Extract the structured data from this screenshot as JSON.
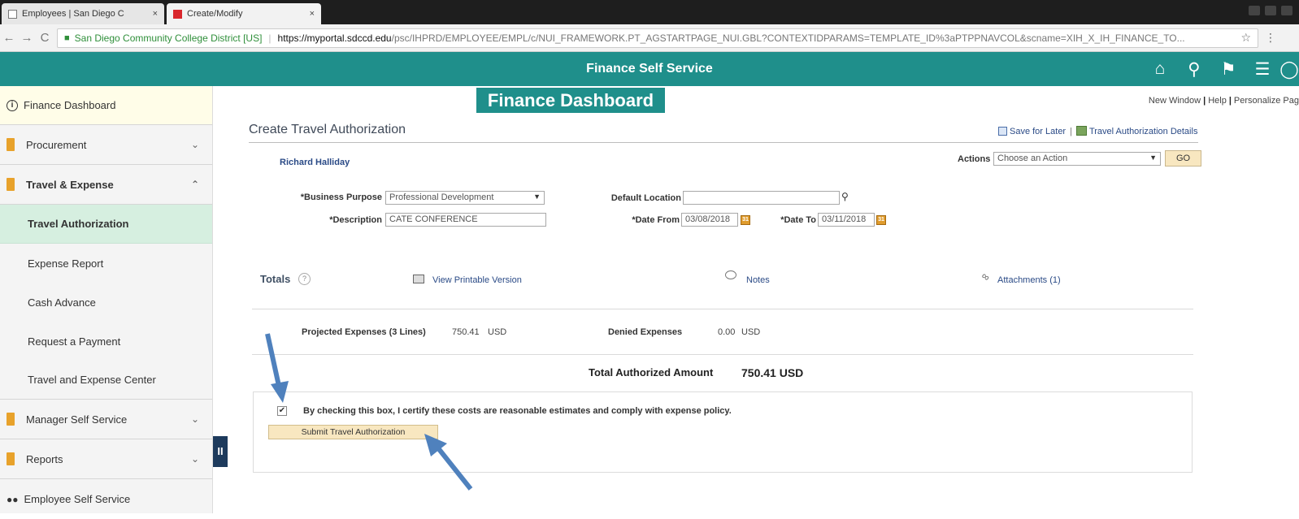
{
  "browser": {
    "tabs": [
      {
        "label": "Employees | San Diego C",
        "close": "×"
      },
      {
        "label": "Create/Modify",
        "close": "×"
      }
    ],
    "secure_label": "San Diego Community College District [US]",
    "url_host": "https://myportal.sdccd.edu",
    "url_path": "/psc/IHPRD/EMPLOYEE/EMPL/c/NUI_FRAMEWORK.PT_AGSTARTPAGE_NUI.GBL?CONTEXTIDPARAMS=TEMPLATE_ID%3aPTPPNAVCOL&scname=XIH_X_IH_FINANCE_TO..."
  },
  "header": {
    "title": "Finance Self Service"
  },
  "sidebar": {
    "items": [
      {
        "label": "Finance Dashboard"
      },
      {
        "label": "Procurement"
      },
      {
        "label": "Travel & Expense"
      },
      {
        "label": "Travel Authorization"
      },
      {
        "label": "Expense Report"
      },
      {
        "label": "Cash Advance"
      },
      {
        "label": "Request a Payment"
      },
      {
        "label": "Travel and Expense Center"
      },
      {
        "label": "Manager Self Service"
      },
      {
        "label": "Reports"
      },
      {
        "label": "Employee Self Service"
      }
    ]
  },
  "page": {
    "banner": "Finance Dashboard",
    "toplinks": {
      "new_window": "New Window",
      "help": "Help",
      "personalize": "Personalize Pag"
    },
    "title": "Create Travel Authorization",
    "save_for_later": "Save for Later",
    "details_link": "Travel Authorization Details",
    "employee_name": "Richard Halliday",
    "actions_label": "Actions",
    "actions_value": "Choose an Action",
    "go_label": "GO",
    "business_purpose_label": "*Business Purpose",
    "business_purpose_value": "Professional Development",
    "default_location_label": "Default Location",
    "default_location_value": "",
    "description_label": "*Description",
    "description_value": "CATE CONFERENCE",
    "date_from_label": "*Date From",
    "date_from_value": "03/08/2018",
    "date_to_label": "*Date To",
    "date_to_value": "03/11/2018",
    "totals_label": "Totals",
    "printable_link": "View Printable Version",
    "notes_link": "Notes",
    "attachments_link": "Attachments (1)",
    "projected_label": "Projected Expenses (3 Lines)",
    "projected_value": "750.41",
    "projected_currency": "USD",
    "denied_label": "Denied Expenses",
    "denied_value": "0.00",
    "denied_currency": "USD",
    "total_auth_label": "Total Authorized Amount",
    "total_auth_value": "750.41  USD",
    "certify_text": "By checking this box, I certify these costs are reasonable estimates and comply with expense policy.",
    "submit_label": "Submit Travel Authorization"
  },
  "colors": {
    "header_teal": "#1f8f8b",
    "active_nav": "#d6efe0",
    "button_tan": "#f8e7c0",
    "arrow_blue": "#4f81bd"
  }
}
